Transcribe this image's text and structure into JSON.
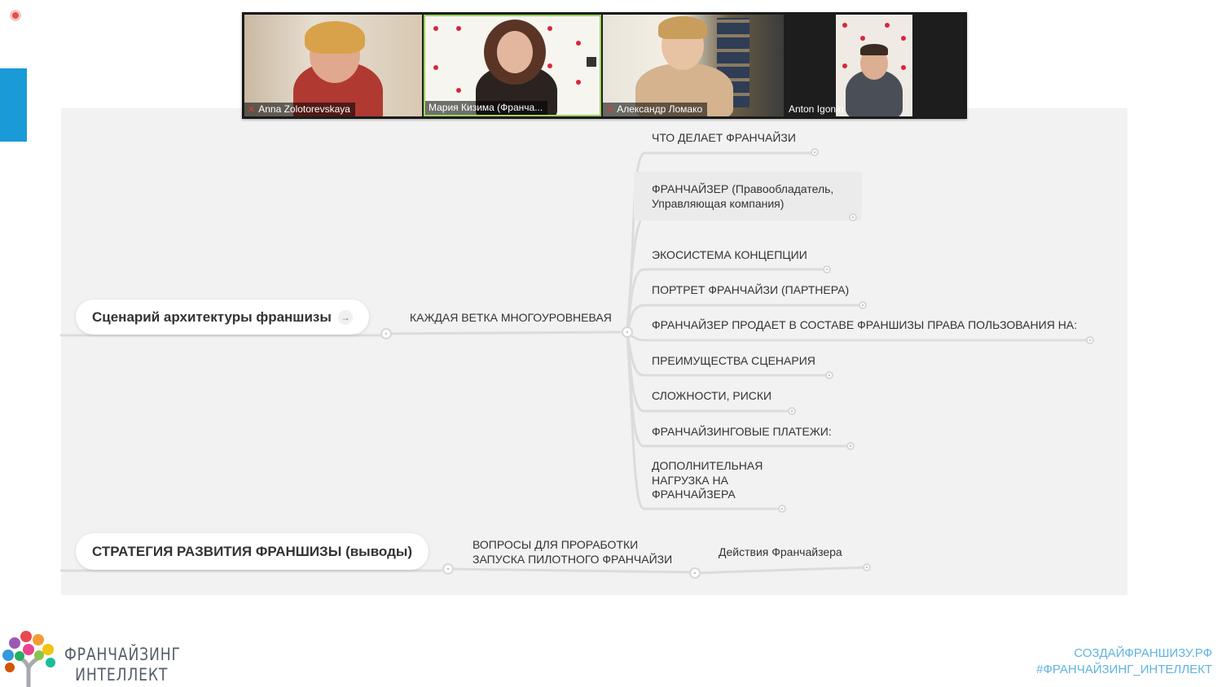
{
  "video_call": {
    "participants": [
      {
        "name": "Anna Zolotorevskaya",
        "muted": true
      },
      {
        "name": "Мария Кизима (Франча...",
        "muted": false,
        "active_speaker": true
      },
      {
        "name": "Александр Ломако",
        "muted": true
      },
      {
        "name": "Anton Igonin",
        "muted": false
      }
    ]
  },
  "mindmap": {
    "root1": {
      "title": "Сценарий архитектуры франшизы",
      "icon": "arrow-right-icon"
    },
    "root1_child": "КАЖДАЯ ВЕТКА МНОГОУРОВНЕВАЯ",
    "branches": [
      "ЧТО ДЕЛАЕТ ФРАНЧАЙЗИ",
      "ФРАНЧАЙЗЕР (Правообладатель, Управляющая компания)",
      "ЭКОСИСТЕМА КОНЦЕПЦИИ",
      "ПОРТРЕТ ФРАНЧАЙЗИ (ПАРТНЕРА)",
      "ФРАНЧАЙЗЕР ПРОДАЕТ В СОСТАВЕ ФРАНШИЗЫ ПРАВА ПОЛЬЗОВАНИЯ НА:",
      "ПРЕИМУЩЕСТВА СЦЕНАРИЯ",
      "СЛОЖНОСТИ, РИСКИ",
      "ФРАНЧАЙЗИНГОВЫЕ ПЛАТЕЖИ:",
      "ДОПОЛНИТЕЛЬНАЯ НАГРУЗКА НА ФРАНЧАЙЗЕРА"
    ],
    "root2": {
      "title": "СТРАТЕГИЯ РАЗВИТИЯ ФРАНШИЗЫ (выводы)"
    },
    "root2_child": "ВОПРОСЫ ДЛЯ ПРОРАБОТКИ ЗАПУСКА ПИЛОТНОГО ФРАНЧАЙЗИ",
    "root2_grandchild": "Действия Франчайзера"
  },
  "brand": {
    "logo_line1": "ФРАНЧАЙЗИНГ",
    "logo_line2": "ИНТЕЛЛЕКТ",
    "site": "СОЗДАЙФРАНШИЗУ.РФ",
    "hashtag": "#ФРАНЧАЙЗИНГ_ИНТЕЛЛЕКТ"
  },
  "colors": {
    "accent_blue": "#1a9ad6",
    "active_speaker": "#9bd45c",
    "footer_link": "#5fb4e0"
  }
}
